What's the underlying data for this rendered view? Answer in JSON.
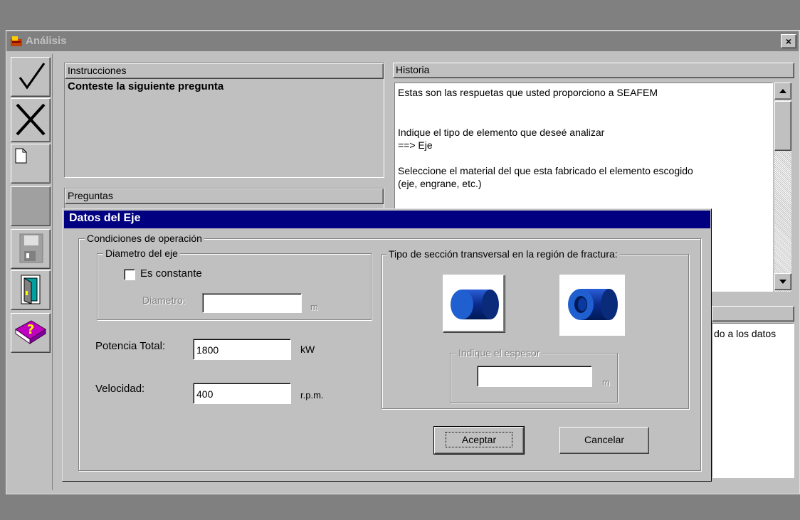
{
  "main_window": {
    "title": "Análisis",
    "close_glyph": "×",
    "app_icon": "app-window-icon"
  },
  "toolbar": {
    "check_icon": "✓",
    "x_icon": "✕",
    "tools": [
      "checkmark-icon",
      "x-icon",
      "new-page-icon",
      "blank-icon",
      "save-disk-icon",
      "exit-door-icon",
      "help-book-icon"
    ],
    "help_glyph": "?"
  },
  "instrucciones": {
    "label": "Instrucciones",
    "text": "Conteste la siguiente pregunta"
  },
  "preguntas": {
    "label": "Preguntas"
  },
  "historia": {
    "label": "Historia",
    "lines": [
      "Estas son las respuetas que usted proporciono a SEAFEM",
      "",
      "",
      "Indique el tipo de elemento que deseé analizar",
      "==> Eje",
      "",
      "Seleccione el material del que esta fabricado el elemento escogido",
      "(eje, engrane, etc.)"
    ]
  },
  "lower_right": {
    "partial_text": "do a los datos"
  },
  "dialog": {
    "title": "Datos del Eje",
    "condiciones_label": "Condiciones de operación",
    "diametro_group_label": "Diametro del eje",
    "es_constante_label": "Es constante",
    "es_constante_checked": false,
    "diametro_label": "Diametro:",
    "diametro_value": "",
    "diametro_unit": "m",
    "potencia_label": "Potencia Total:",
    "potencia_value": "1800",
    "potencia_unit": "kW",
    "velocidad_label": "Velocidad:",
    "velocidad_value": "400",
    "velocidad_unit": "r.p.m.",
    "seccion_group_label": "Tipo de sección transversal en la región de fractura:",
    "seccion_options": [
      "solid-shaft-icon",
      "hollow-shaft-icon"
    ],
    "espesor_group_label": "Indique el espesor",
    "espesor_value": "",
    "espesor_unit": "m",
    "aceptar_label": "Aceptar",
    "cancelar_label": "Cancelar",
    "colors": {
      "titlebar": "#000080",
      "shaft_blue": "#1f4fbf"
    }
  }
}
